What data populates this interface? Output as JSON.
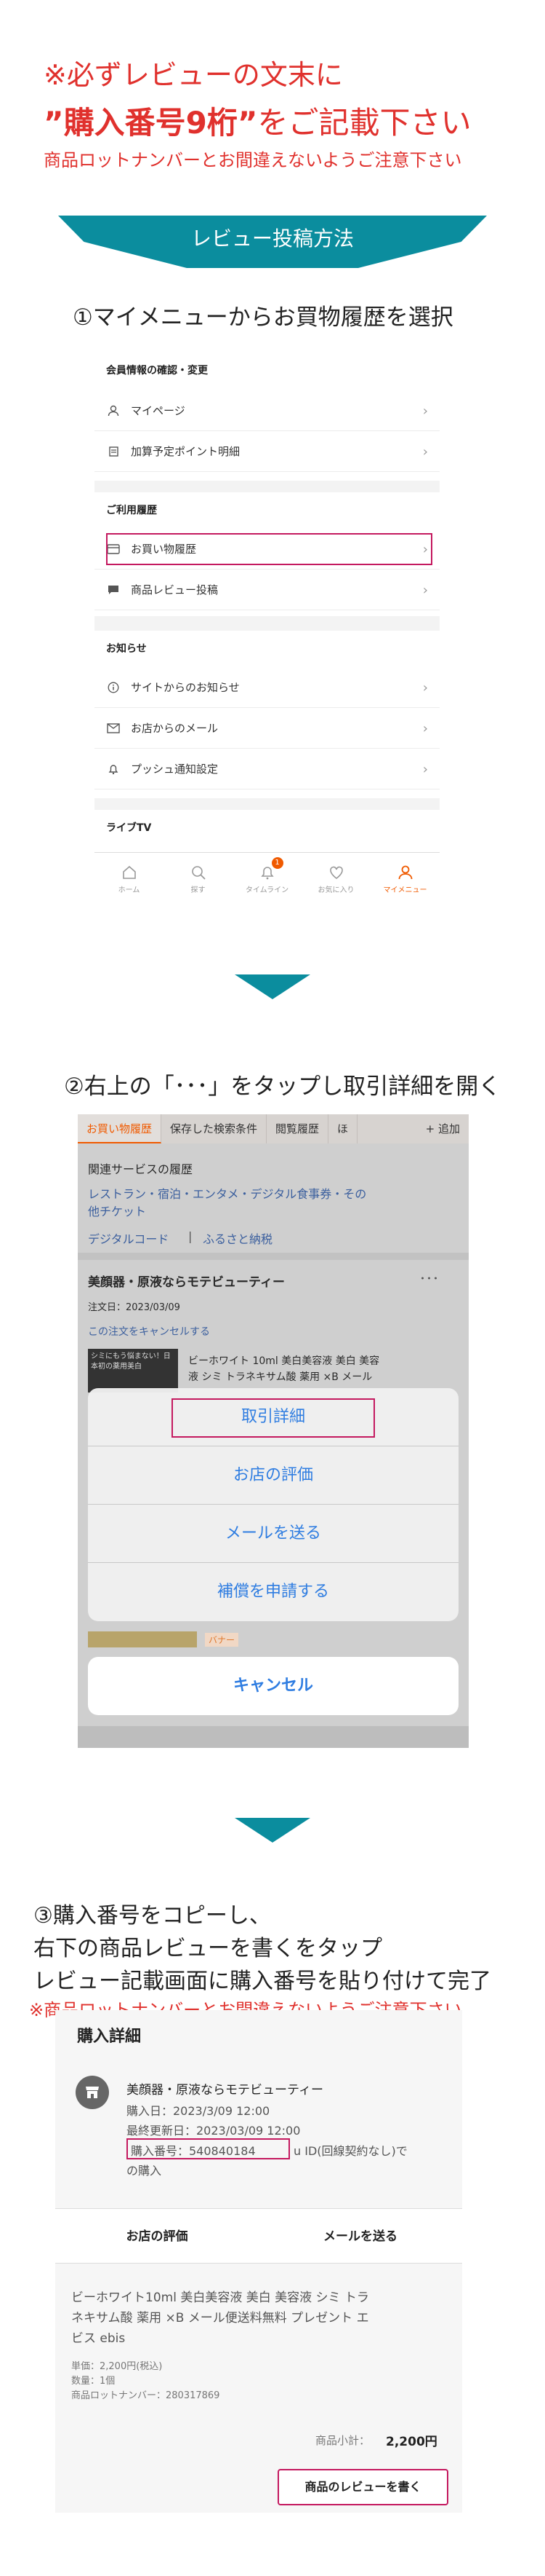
{
  "header": {
    "line1": "※必ずレビューの文末に",
    "line2_main": "”購入番号9桁”",
    "line2_tail": "をご記載下さい",
    "line3": "商品ロットナンバーとお間違えないようご注意下さい"
  },
  "banner": "レビュー投稿方法",
  "steps": {
    "s1": "①マイメニューからお買物履歴を選択",
    "s2": "②右上の「･･･」をタップし取引詳細を開く",
    "s3_l1": "③購入番号をコピーし、",
    "s3_l2": "右下の商品レビューを書くをタップ",
    "s3_l3": "レビュー記載画面に購入番号を貼り付けて完了",
    "s3_note": "※商品ロットナンバーとお間違えないようご注意下さい"
  },
  "menu": {
    "sec1_title": "会員情報の確認・変更",
    "mypage": "マイページ",
    "points": "加算予定ポイント明細",
    "sec2_title": "ご利用履歴",
    "history": "お買い物履歴",
    "review": "商品レビュー投稿",
    "sec3_title": "お知らせ",
    "site_notice": "サイトからのお知らせ",
    "shop_mail": "お店からのメール",
    "push": "プッシュ通知設定",
    "sec4_title": "ライブTV",
    "tabs": [
      "ホーム",
      "探す",
      "タイムライン",
      "お気に入り",
      "マイメニュー"
    ],
    "badge": "1"
  },
  "panel2": {
    "tabs": [
      "お買い物履歴",
      "保存した検索条件",
      "閲覧履歴",
      "ほ"
    ],
    "add": "+ 追加",
    "related_title": "関連サービスの履歴",
    "related_links": "レストラン・宿泊・エンタメ・デジタル食事券・その",
    "related_links2": "他チケット",
    "digital": "デジタルコード",
    "sep": "|",
    "furusato": "ふるさと納税",
    "shop": "美顔器・原液ならモテビューティー",
    "dots": "･･･",
    "order_date": "注文日：2023/03/09",
    "cancel_order": "この注文をキャンセルする",
    "thumb_text": "シミにもう悩まない！日本初の薬用美白",
    "product": "ビーホワイト 10ml 美白美容液 美白 美容",
    "product2": "液 シミ トラネキサム酸 薬用 ×B メール",
    "sheet": [
      "取引詳細",
      "お店の評価",
      "メールを送る",
      "補償を申請する"
    ],
    "cancel": "キャンセル",
    "badge_tag": "バナー"
  },
  "panel3": {
    "title": "購入詳細",
    "shop": "美顔器・原液ならモテビューティー",
    "purchase_date": "購入日：2023/3/09 12:00",
    "updated": "最終更新日：2023/03/09 12:00",
    "order_no": "購入番号：540840184",
    "order_tail": "u ID(回線契約なし)で",
    "order_tail2": "の購入",
    "btn_eval": "お店の評価",
    "btn_mail": "メールを送る",
    "product": "ビーホワイト10ml 美白美容液 美白 美容液 シミ トラ",
    "product2": "ネキサム酸 薬用 ×B メール便送料無料 プレゼント エ",
    "product3": "ビス ebis",
    "price": "単価：2,200円(税込)",
    "qty": "数量：1個",
    "lot": "商品ロットナンバー：280317869",
    "subtotal_label": "商品小計：",
    "subtotal": "2,200円",
    "review_btn": "商品のレビューを書く"
  },
  "colors": {
    "accent": "#e0312d",
    "teal": "#0b8d9e",
    "highlight": "#c4195f",
    "rakuten_orange": "#f05a00",
    "ios_blue": "#2f7de1"
  }
}
